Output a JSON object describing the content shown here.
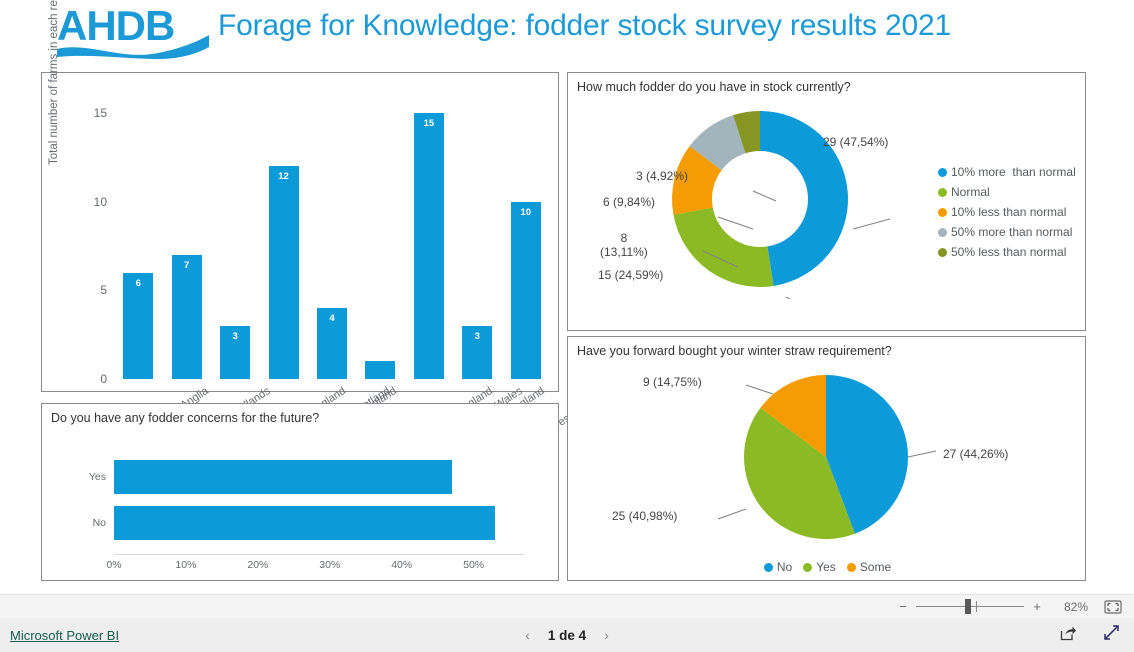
{
  "header": {
    "logo_alt": "AHDB",
    "title": "Forage for Knowledge: fodder stock survey results 2021",
    "title_color": "#1c9ad6",
    "logo_color": "#1b9ad7"
  },
  "colors": {
    "blue": "#0c9ad8",
    "green": "#8cba25",
    "orange": "#f59c04",
    "grayblue": "#a2b4bc",
    "olive": "#859623"
  },
  "panels": {
    "regions": {
      "title": ""
    },
    "concerns": {
      "title": "Do you have any fodder concerns for the future?"
    },
    "stock": {
      "title": "How much fodder do you have in stock currently?"
    },
    "straw": {
      "title": "Have you forward bought your winter straw requirement?"
    }
  },
  "chart_data": [
    {
      "type": "bar",
      "id": "regions",
      "title": "",
      "xlabel": "",
      "ylabel": "Total number of farms in each region",
      "categories": [
        "East Anglia",
        "East Midlands",
        "North East England",
        "North West England",
        "Scotland",
        "South East England",
        "South West England",
        "Wales",
        "West Midlands"
      ],
      "values": [
        6,
        7,
        3,
        12,
        4,
        1,
        15,
        3,
        10
      ],
      "value_labels": [
        "6",
        "7",
        "3",
        "12",
        "4",
        "",
        "15",
        "3",
        "10"
      ],
      "yticks": [
        0,
        5,
        10,
        15
      ],
      "ylim": [
        0,
        16
      ],
      "grid": false,
      "series_color": "#0c9ad8"
    },
    {
      "type": "bar",
      "id": "concerns",
      "orientation": "horizontal",
      "title": "Do you have any fodder concerns for the future?",
      "xlabel": "",
      "ylabel": "",
      "categories": [
        "Yes",
        "No"
      ],
      "values": [
        47,
        53
      ],
      "xticks": [
        "0%",
        "10%",
        "20%",
        "30%",
        "40%",
        "50%"
      ],
      "xlim": [
        0,
        57
      ],
      "grid": false,
      "series_color": "#0c9ad8"
    },
    {
      "type": "pie",
      "id": "stock",
      "variant": "donut",
      "title": "How much fodder do you have in stock currently?",
      "legend_position": "right",
      "labels": [
        "10% more  than normal",
        "Normal",
        "10% less than normal",
        "50% more than normal",
        "50% less than normal"
      ],
      "values": [
        29,
        15,
        8,
        6,
        3
      ],
      "percents": [
        "47,54%",
        "24,59%",
        "13,11%",
        "9,84%",
        "4,92%"
      ],
      "data_labels": [
        "29 (47,54%)",
        "15 (24,59%)",
        "8\n(13,11%)",
        "6 (9,84%)",
        "3 (4,92%)"
      ],
      "colors": [
        "#0c9ad8",
        "#8cba25",
        "#f59c04",
        "#a2b4bc",
        "#859623"
      ]
    },
    {
      "type": "pie",
      "id": "straw",
      "variant": "pie",
      "title": "Have you forward bought your winter straw requirement?",
      "legend_position": "bottom",
      "labels": [
        "No",
        "Yes",
        "Some"
      ],
      "values": [
        27,
        25,
        9
      ],
      "percents": [
        "44,26%",
        "40,98%",
        "14,75%"
      ],
      "data_labels": [
        "27 (44,26%)",
        "25 (40,98%)",
        "9 (14,75%)"
      ],
      "colors": [
        "#0c9ad8",
        "#8cba25",
        "#f59c04"
      ]
    }
  ],
  "zoombar": {
    "minus": "−",
    "plus": "+",
    "zoom_level": "82%",
    "fit_icon": "fit-to-page-icon"
  },
  "statusbar": {
    "brand_link": "Microsoft Power BI",
    "prev_arrow": "‹",
    "page_label": "1 de 4",
    "next_arrow": "›",
    "share_icon": "share-icon",
    "fullscreen_icon": "fullscreen-icon"
  }
}
